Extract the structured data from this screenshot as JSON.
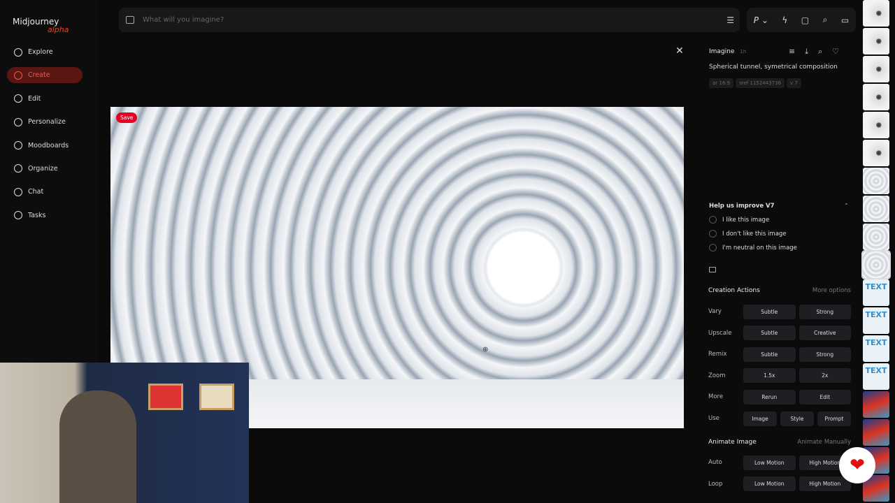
{
  "app": {
    "logo": "Midjourney",
    "logo_suffix": "alpha"
  },
  "sidebar": {
    "items": [
      {
        "label": "Explore"
      },
      {
        "label": "Create",
        "active": true
      },
      {
        "label": "Edit"
      },
      {
        "label": "Personalize"
      },
      {
        "label": "Moodboards"
      },
      {
        "label": "Organize"
      },
      {
        "label": "Chat"
      },
      {
        "label": "Tasks"
      }
    ]
  },
  "search": {
    "placeholder": "What will you imagine?"
  },
  "toolbar": {
    "profile_label": "P"
  },
  "image": {
    "save_label": "Save"
  },
  "detail": {
    "type": "Imagine",
    "age": "1h",
    "prompt": "Spherical tunnel, symetrical composition",
    "tags": [
      "ar 16:9",
      "sref 1152443736",
      "v 7"
    ]
  },
  "feedback": {
    "title": "Help us improve V7",
    "options": [
      "I like this image",
      "I don't like this image",
      "I'm neutral on this image"
    ]
  },
  "creation": {
    "title": "Creation Actions",
    "more": "More options",
    "rows": [
      {
        "label": "Vary",
        "buttons": [
          "Subtle",
          "Strong"
        ]
      },
      {
        "label": "Upscale",
        "buttons": [
          "Subtle",
          "Creative"
        ]
      },
      {
        "label": "Remix",
        "buttons": [
          "Subtle",
          "Strong"
        ]
      },
      {
        "label": "Zoom",
        "buttons": [
          "1.5x",
          "2x"
        ]
      },
      {
        "label": "More",
        "buttons": [
          "Rerun",
          "Edit"
        ]
      },
      {
        "label": "Use",
        "buttons": [
          "Image",
          "Style",
          "Prompt"
        ]
      }
    ]
  },
  "animate": {
    "title": "Animate Image",
    "more": "Animate Manually",
    "rows": [
      {
        "label": "Auto",
        "buttons": [
          "Low Motion",
          "High Motion"
        ]
      },
      {
        "label": "Loop",
        "buttons": [
          "Low Motion",
          "High Motion"
        ]
      }
    ]
  },
  "thumbs": {
    "text_label": "TEXT"
  }
}
